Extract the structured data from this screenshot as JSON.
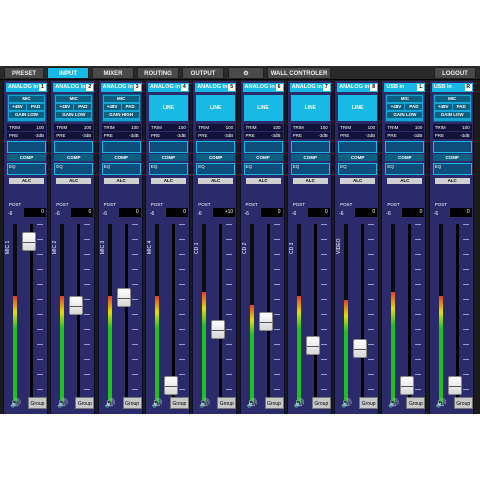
{
  "tabs": {
    "preset": "PRESET",
    "input": "INPUT",
    "mixer": "MIXER",
    "routing": "ROUTING",
    "output": "OUTPUT",
    "wall": "WALL CONTROLER",
    "logout": "LOGOUT"
  },
  "strip_common": {
    "mic": "MIC",
    "p48": "+48V",
    "pad": "PAD",
    "gain_low": "GAIN LOW",
    "gain_high": "GAIN HIGH",
    "trim": "TRIM",
    "trim_value": "100",
    "pre": "PRE",
    "pre_value": "-3dB",
    "comp": "COMP",
    "eq": "EQ",
    "alc": "ALC",
    "post": "POST",
    "post_value": "-6",
    "group": "Group",
    "line": "LINE"
  },
  "channels": [
    {
      "title": "ANALOG in",
      "num": "1",
      "name": "MIC 1",
      "type": "mic",
      "gain": "0",
      "fader": 0.95,
      "meter": 0.6
    },
    {
      "title": "ANALOG in",
      "num": "2",
      "name": "MIC 2",
      "type": "mic",
      "gain": "0",
      "fader": 0.55,
      "meter": 0.6
    },
    {
      "title": "ANALOG in",
      "num": "3",
      "name": "MIC 3",
      "type": "mic",
      "gain": "0",
      "fader": 0.6,
      "meter": 0.6
    },
    {
      "title": "ANALOG in",
      "num": "4",
      "name": "MIC 4",
      "type": "line",
      "gain": "0",
      "fader": 0.05,
      "meter": 0.6
    },
    {
      "title": "ANALOG in",
      "num": "5",
      "name": "CD 1",
      "type": "line",
      "gain": "+10",
      "fader": 0.4,
      "meter": 0.62
    },
    {
      "title": "ANALOG in",
      "num": "6",
      "name": "CD 2",
      "type": "line",
      "gain": "0",
      "fader": 0.45,
      "meter": 0.55
    },
    {
      "title": "ANALOG in",
      "num": "7",
      "name": "CD 3",
      "type": "line",
      "gain": "0",
      "fader": 0.3,
      "meter": 0.6
    },
    {
      "title": "ANALOG in",
      "num": "8",
      "name": "VIDEO",
      "type": "line",
      "gain": "0",
      "fader": 0.28,
      "meter": 0.58
    },
    {
      "title": "USB in",
      "num": "L",
      "name": "",
      "type": "usb",
      "gain": "0",
      "fader": 0.05,
      "meter": 0.62
    },
    {
      "title": "USB in",
      "num": "R",
      "name": "",
      "type": "usb",
      "gain": "0",
      "fader": 0.05,
      "meter": 0.6
    }
  ]
}
